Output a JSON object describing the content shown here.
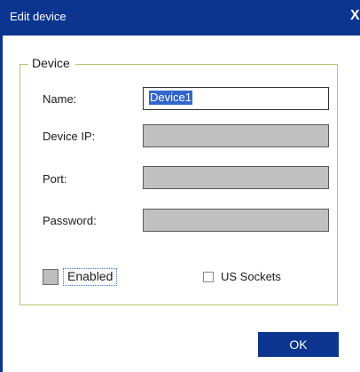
{
  "window": {
    "title": "Edit device",
    "close_glyph": "X"
  },
  "group": {
    "label": "Device"
  },
  "fields": {
    "name": {
      "label": "Name:",
      "value": "Device1"
    },
    "device_ip": {
      "label": "Device IP:",
      "value": ""
    },
    "port": {
      "label": "Port:",
      "value": ""
    },
    "password": {
      "label": "Password:",
      "value": ""
    }
  },
  "options": {
    "enabled_label": "Enabled",
    "us_sockets_label": "US Sockets"
  },
  "buttons": {
    "ok_label": "OK"
  },
  "colors": {
    "titlebar": "#0c3590",
    "group_border": "#b6c46a",
    "disabled_field": "#c0c0c0",
    "selection": "#3366cc"
  },
  "icons": {
    "close": "close-icon"
  }
}
